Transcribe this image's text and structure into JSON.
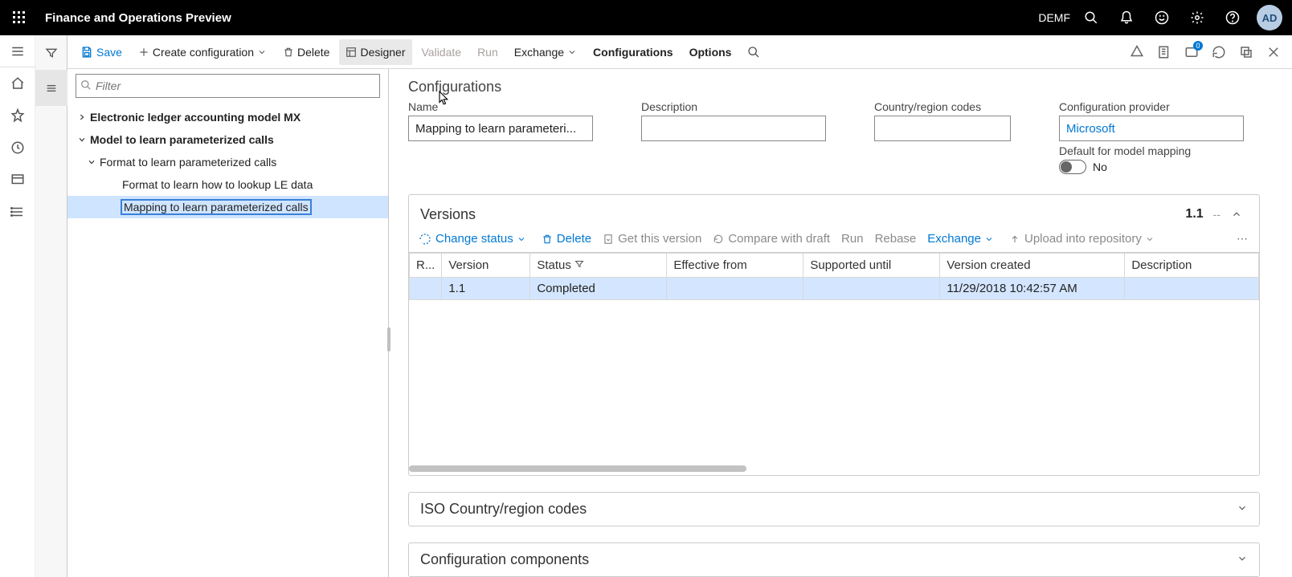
{
  "topbar": {
    "title": "Finance and Operations Preview",
    "entity": "DEMF",
    "avatar": "AD"
  },
  "cmdbar": {
    "save": "Save",
    "create_config": "Create configuration",
    "delete": "Delete",
    "designer": "Designer",
    "validate": "Validate",
    "run": "Run",
    "exchange": "Exchange",
    "configurations": "Configurations",
    "options": "Options",
    "badge_count": "0"
  },
  "filter": {
    "placeholder": "Filter"
  },
  "tree": {
    "n0": "Electronic ledger accounting model MX",
    "n1": "Model to learn parameterized calls",
    "n2": "Format to learn parameterized calls",
    "n3": "Format to learn how to lookup LE data",
    "n4": "Mapping to learn parameterized calls"
  },
  "details": {
    "section_title": "Configurations",
    "name_label": "Name",
    "name_value": "Mapping to learn parameteri...",
    "desc_label": "Description",
    "desc_value": "",
    "cc_label": "Country/region codes",
    "cc_value": "",
    "provider_label": "Configuration provider",
    "provider_value": "Microsoft",
    "default_mm_label": "Default for model mapping",
    "default_mm_state": "No"
  },
  "versions": {
    "title": "Versions",
    "header_version": "1.1",
    "header_dash": "--",
    "toolbar": {
      "change_status": "Change status",
      "delete": "Delete",
      "get_version": "Get this version",
      "compare_draft": "Compare with draft",
      "run": "Run",
      "rebase": "Rebase",
      "exchange": "Exchange",
      "upload_repo": "Upload into repository"
    },
    "columns": {
      "r": "R...",
      "version": "Version",
      "status": "Status",
      "effective_from": "Effective from",
      "supported_until": "Supported until",
      "version_created": "Version created",
      "description": "Description"
    },
    "rows": [
      {
        "r": "",
        "version": "1.1",
        "status": "Completed",
        "effective_from": "",
        "supported_until": "",
        "version_created": "11/29/2018 10:42:57 AM",
        "description": ""
      }
    ]
  },
  "sections": {
    "iso": "ISO Country/region codes",
    "components": "Configuration components"
  }
}
